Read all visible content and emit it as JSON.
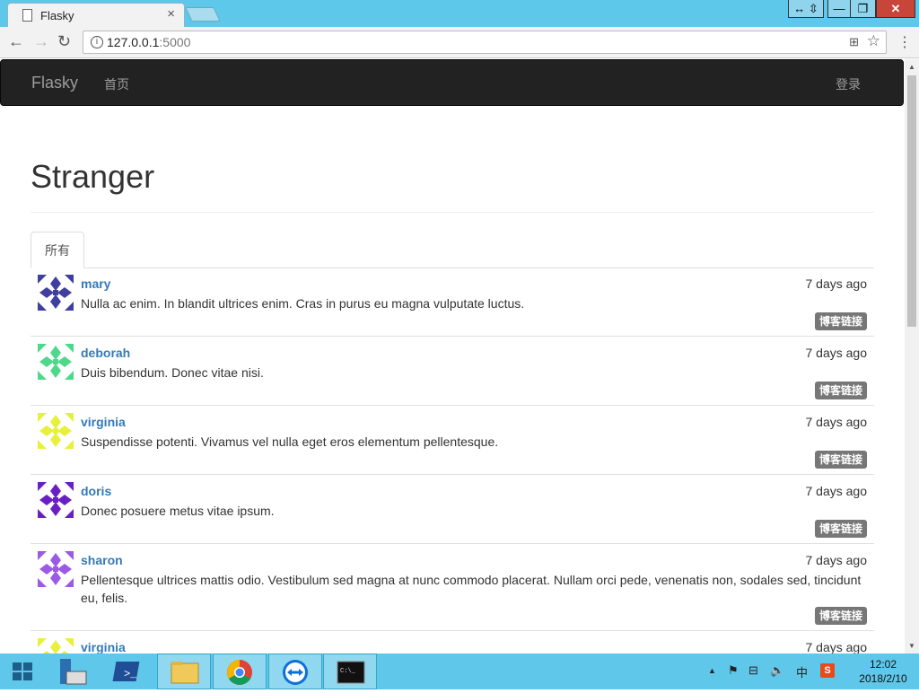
{
  "browser": {
    "tab_title": "Flasky",
    "tab_close": "×",
    "url_host": "127.0.0.1",
    "url_port": ":5000",
    "window_buttons": {
      "extra": "↔ ⇳",
      "minimize": "—",
      "maximize": "❐",
      "close": "✕"
    }
  },
  "navbar": {
    "brand": "Flasky",
    "home": "首页",
    "login": "登录"
  },
  "page": {
    "title": "Stranger",
    "tabs": [
      {
        "label": "所有"
      }
    ]
  },
  "posts": [
    {
      "author": "mary",
      "date": "7 days ago",
      "body": "Nulla ac enim. In blandit ultrices enim. Cras in purus eu magna vulputate luctus.",
      "badge": "博客链接",
      "avatar_color": "#3f3f9f"
    },
    {
      "author": "deborah",
      "date": "7 days ago",
      "body": "Duis bibendum. Donec vitae nisi.",
      "badge": "博客链接",
      "avatar_color": "#4ed98a"
    },
    {
      "author": "virginia",
      "date": "7 days ago",
      "body": "Suspendisse potenti. Vivamus vel nulla eget eros elementum pellentesque.",
      "badge": "博客链接",
      "avatar_color": "#e8f03a"
    },
    {
      "author": "doris",
      "date": "7 days ago",
      "body": "Donec posuere metus vitae ipsum.",
      "badge": "博客链接",
      "avatar_color": "#6a1fc4"
    },
    {
      "author": "sharon",
      "date": "7 days ago",
      "body": "Pellentesque ultrices mattis odio. Vestibulum sed magna at nunc commodo placerat. Nullam orci pede, venenatis non, sodales sed, tincidunt eu, felis.",
      "badge": "博客链接",
      "avatar_color": "#9b59e6"
    },
    {
      "author": "virginia",
      "date": "7 days ago",
      "body": "",
      "badge": "",
      "avatar_color": "#e8f03a"
    }
  ],
  "taskbar": {
    "time": "12:02",
    "date": "2018/2/10",
    "ime": "中"
  },
  "colors": {
    "link": "#337ab7",
    "navbar": "#222222",
    "badge": "#777777",
    "titlebar": "#5ec8ea"
  }
}
